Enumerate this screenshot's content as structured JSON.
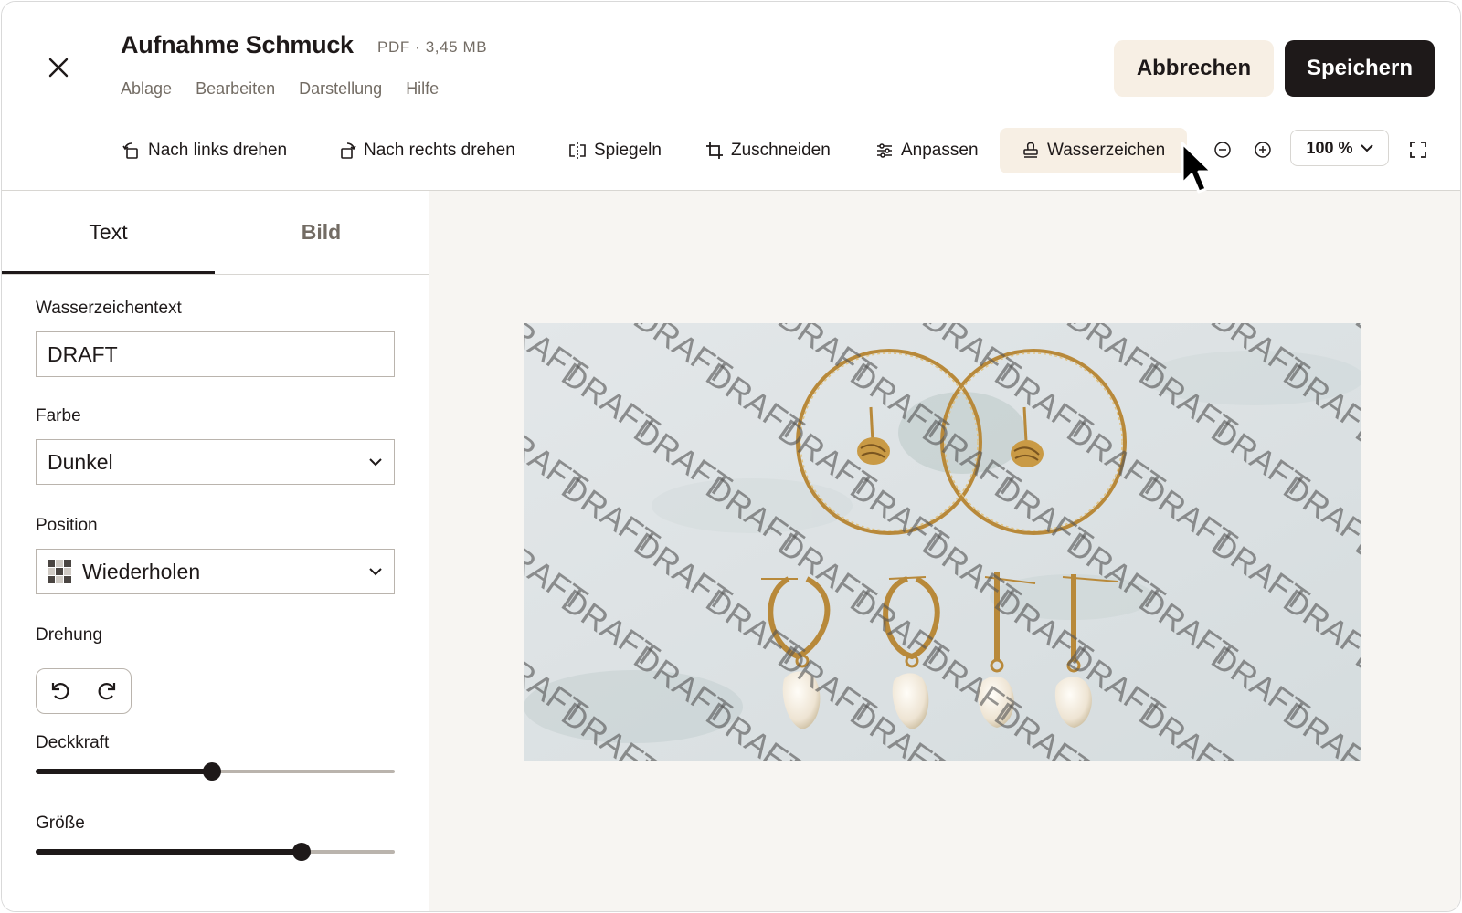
{
  "header": {
    "title": "Aufnahme Schmuck",
    "file_meta": "PDF  ·  3,45 MB",
    "menu": [
      "Ablage",
      "Bearbeiten",
      "Darstellung",
      "Hilfe"
    ],
    "cancel_label": "Abbrechen",
    "save_label": "Speichern"
  },
  "toolbar": {
    "rotate_left": "Nach links drehen",
    "rotate_right": "Nach rechts drehen",
    "mirror": "Spiegeln",
    "crop": "Zuschneiden",
    "adjust": "Anpassen",
    "watermark": "Wasserzeichen",
    "zoom": "100 %"
  },
  "sidebar": {
    "tabs": [
      "Text",
      "Bild"
    ],
    "active_tab": "Text",
    "text_label": "Wasserzeichentext",
    "text_value": "DRAFT",
    "color_label": "Farbe",
    "color_value": "Dunkel",
    "position_label": "Position",
    "position_value": "Wiederholen",
    "rotation_label": "Drehung",
    "opacity_label": "Deckkraft",
    "opacity_value": 0.49,
    "size_label": "Größe",
    "size_value": 0.74
  },
  "preview": {
    "watermark_text": "DRAFT"
  },
  "colors": {
    "accent_bg": "#f7efe4",
    "primary": "#1e1919",
    "muted": "#736c64",
    "border": "#d8d6d2",
    "canvas_bg": "#f7f5f2",
    "gold": "#b8893a"
  }
}
